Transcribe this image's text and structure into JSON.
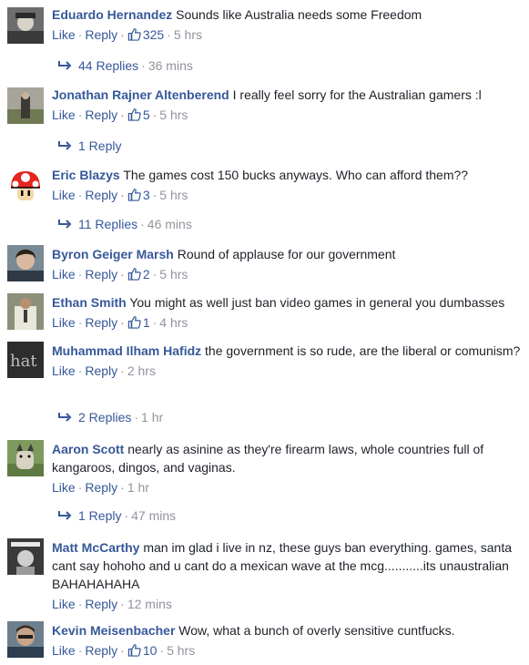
{
  "ui": {
    "like": "Like",
    "reply": "Reply",
    "sep": "·",
    "accent": "#365899",
    "muted": "#90949c"
  },
  "comments": [
    {
      "name": "Eduardo Hernandez",
      "text": "Sounds like Australia needs some Freedom",
      "likes": "325",
      "time": "5 hrs",
      "replies": "44 Replies",
      "replies_time": "36 mins"
    },
    {
      "name": "Jonathan Rajner Altenberend",
      "text": "I really feel sorry for the Australian gamers :l",
      "likes": "5",
      "time": "5 hrs",
      "replies": "1 Reply",
      "replies_time": ""
    },
    {
      "name": "Eric Blazys",
      "text": "The games cost 150 bucks anyways. Who can afford them??",
      "likes": "3",
      "time": "5 hrs",
      "replies": "11 Replies",
      "replies_time": "46 mins"
    },
    {
      "name": "Byron Geiger Marsh",
      "text": "Round of applause for our government",
      "likes": "2",
      "time": "5 hrs",
      "replies": "",
      "replies_time": ""
    },
    {
      "name": "Ethan Smith",
      "text": "You might as well just ban video games in general you dumbasses",
      "likes": "1",
      "time": "4 hrs",
      "replies": "",
      "replies_time": ""
    },
    {
      "name": "Muhammad Ilham Hafidz",
      "text": "the government is so rude, are the liberal or comunism?",
      "likes": "",
      "time": "2 hrs",
      "replies": "2 Replies",
      "replies_time": "1 hr"
    },
    {
      "name": "Aaron Scott",
      "text": "nearly as asinine as they're firearm laws, whole countries full of kangaroos, dingos, and vaginas.",
      "likes": "",
      "time": "1 hr",
      "replies": "1 Reply",
      "replies_time": "47 mins"
    },
    {
      "name": "Matt McCarthy",
      "text": "man im glad i live in nz, these guys ban everything. games, santa cant say hohoho and u cant do a mexican wave at the mcg...........its unaustralian BAHAHAHAHA",
      "likes": "",
      "time": "12 mins",
      "replies": "",
      "replies_time": ""
    },
    {
      "name": "Kevin Meisenbacher",
      "text": "Wow, what a bunch of overly sensitive cuntfucks.",
      "likes": "10",
      "time": "5 hrs",
      "replies": "",
      "replies_time": ""
    }
  ]
}
